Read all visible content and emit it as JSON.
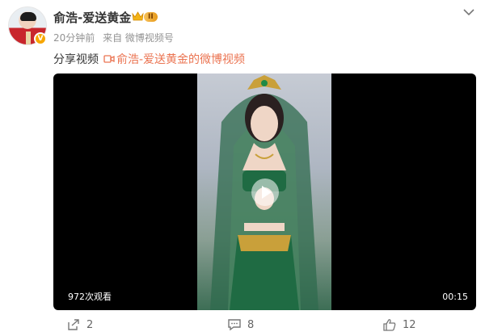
{
  "post": {
    "username": "俞浩-爱送黄金",
    "level": "II",
    "verified_mark": "V",
    "time": "20分钟前",
    "source": "来自 微博视频号",
    "share_prefix": "分享视频",
    "share_link": "俞浩-爱送黄金的微博视频"
  },
  "video": {
    "views": "972次观看",
    "duration": "00:15"
  },
  "actions": {
    "repost_count": "2",
    "comment_count": "8",
    "like_count": "12"
  },
  "colors": {
    "link": "#eb7350",
    "meta": "#939393",
    "player_bg": "#000000"
  },
  "icons": [
    "crown-icon",
    "chevron-down-icon",
    "video-link-icon",
    "play-icon",
    "repost-icon",
    "comment-icon",
    "like-icon"
  ]
}
